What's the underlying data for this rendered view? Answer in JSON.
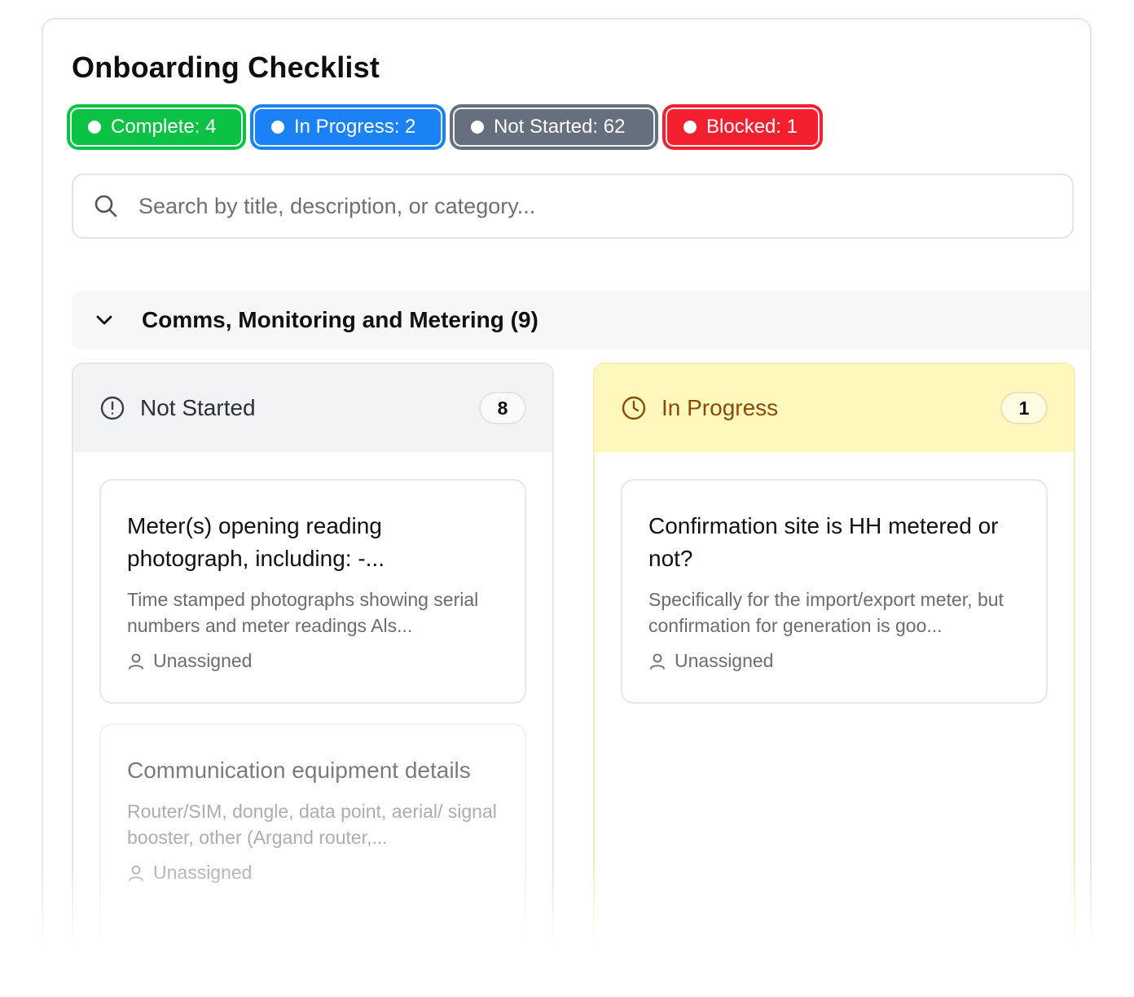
{
  "header": {
    "title": "Onboarding Checklist"
  },
  "status_pills": [
    {
      "label": "Complete: 4",
      "color": "#0bc244"
    },
    {
      "label": "In Progress: 2",
      "color": "#1a82f5"
    },
    {
      "label": "Not Started: 62",
      "color": "#666f7d"
    },
    {
      "label": "Blocked: 1",
      "color": "#f5202f"
    }
  ],
  "search": {
    "placeholder": "Search by title, description, or category...",
    "value": ""
  },
  "group": {
    "title": "Comms, Monitoring and Metering (9)",
    "expanded": true
  },
  "columns": [
    {
      "title": "Not Started",
      "count": "8",
      "icon": "alert-circle-icon",
      "header_color": "#f2f3f5",
      "cards": [
        {
          "title": "Meter(s) opening reading photograph, including: -...",
          "description": "Time stamped photographs showing serial numbers and meter readings Als...",
          "assignee": "Unassigned"
        },
        {
          "title": "Communication equipment details",
          "description": "Router/SIM, dongle, data point, aerial/ signal booster, other (Argand router,...",
          "assignee": "Unassigned"
        }
      ]
    },
    {
      "title": "In Progress",
      "count": "1",
      "icon": "clock-icon",
      "header_color": "#fef8bd",
      "cards": [
        {
          "title": "Confirmation site is HH metered or not?",
          "description": "Specifically for the import/export meter, but confirmation for generation is goo...",
          "assignee": "Unassigned"
        }
      ]
    }
  ]
}
